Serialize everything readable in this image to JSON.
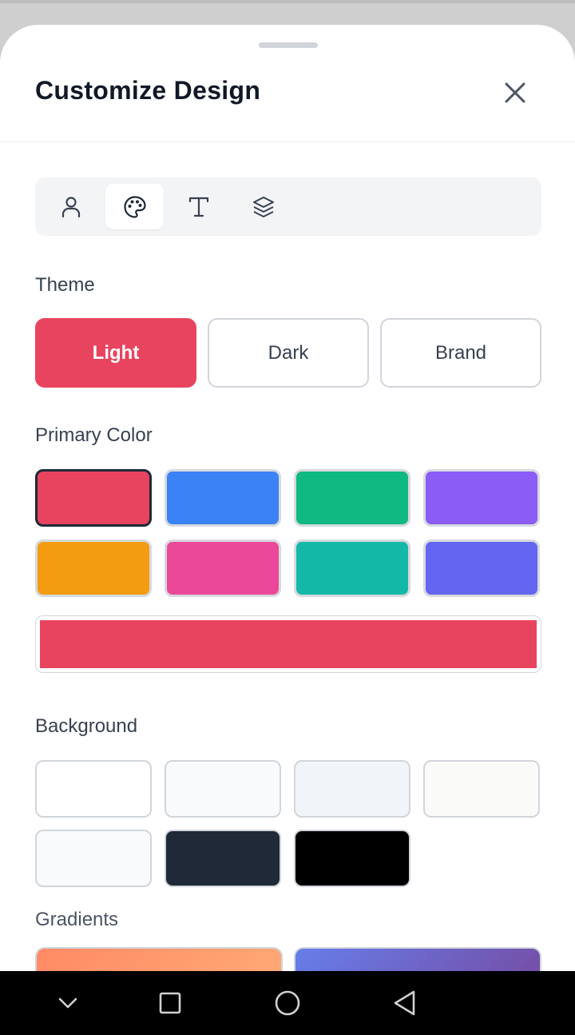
{
  "sheet": {
    "title": "Customize Design",
    "close_icon": "close-icon"
  },
  "tabs": [
    {
      "icon": "person-icon",
      "active": false
    },
    {
      "icon": "palette-icon",
      "active": true
    },
    {
      "icon": "text-icon",
      "active": false
    },
    {
      "icon": "layers-icon",
      "active": false
    }
  ],
  "theme": {
    "label": "Theme",
    "options": [
      "Light",
      "Dark",
      "Brand"
    ],
    "selected": "Light"
  },
  "primary_color": {
    "label": "Primary Color",
    "swatches": [
      "#e9445f",
      "#3b82f6",
      "#10b981",
      "#8b5cf6",
      "#f39c12",
      "#ec4899",
      "#14b8a6",
      "#6366f1"
    ],
    "selected": "#e9445f",
    "custom_value": "#e9445f"
  },
  "background": {
    "label": "Background",
    "swatches": [
      "#ffffff",
      "#f8fafc",
      "#f1f5f9",
      "#fafaf9",
      "#f9fafb",
      "#1f2937",
      "#000000"
    ]
  },
  "gradients": {
    "label": "Gradients",
    "items": [
      {
        "from": "#ff8a65",
        "to": "#ffab76"
      },
      {
        "from": "#667eea",
        "to": "#764ba2"
      }
    ]
  },
  "nav": {
    "buttons": [
      "chevron-down-icon",
      "recents-square-icon",
      "home-circle-icon",
      "back-triangle-icon"
    ]
  }
}
